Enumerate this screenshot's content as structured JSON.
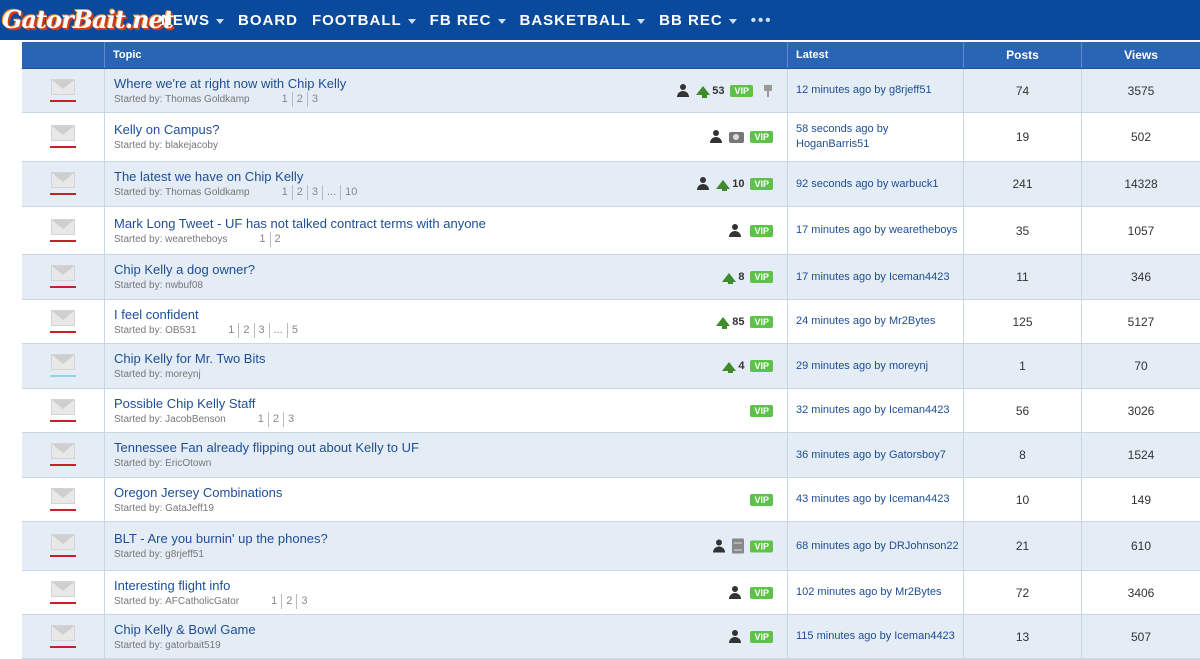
{
  "site": {
    "logo_text": "GatorBait.net"
  },
  "nav": {
    "items": [
      {
        "label": "NEWS",
        "dropdown": true
      },
      {
        "label": "BOARD",
        "dropdown": false
      },
      {
        "label": "FOOTBALL",
        "dropdown": true
      },
      {
        "label": "FB REC",
        "dropdown": true
      },
      {
        "label": "BASKETBALL",
        "dropdown": true
      },
      {
        "label": "BB REC",
        "dropdown": true
      }
    ],
    "more": "•••"
  },
  "table": {
    "headers": {
      "topic": "Topic",
      "latest": "Latest",
      "posts": "Posts",
      "views": "Views"
    },
    "started_prefix": "Started by:",
    "rows": [
      {
        "title": "Where we're at right now with Chip Kelly",
        "author": "Thomas Goldkamp",
        "pages": [
          "1",
          "2",
          "3"
        ],
        "person": true,
        "up": "53",
        "camera": false,
        "doc": false,
        "vip": true,
        "pin": true,
        "latest": "12 minutes ago by g8rjeff51",
        "posts": "74",
        "views": "3575",
        "bar": "red"
      },
      {
        "title": "Kelly on Campus?",
        "author": "blakejacoby",
        "pages": [],
        "person": true,
        "up": "",
        "camera": true,
        "doc": false,
        "vip": true,
        "pin": false,
        "latest": "58 seconds ago by HoganBarris51",
        "posts": "19",
        "views": "502",
        "bar": "red"
      },
      {
        "title": "The latest we have on Chip Kelly",
        "author": "Thomas Goldkamp",
        "pages": [
          "1",
          "2",
          "3",
          "...",
          "10"
        ],
        "person": true,
        "up": "10",
        "camera": false,
        "doc": false,
        "vip": true,
        "pin": false,
        "latest": "92 seconds ago by warbuck1",
        "posts": "241",
        "views": "14328",
        "bar": "red"
      },
      {
        "title": "Mark Long Tweet - UF has not talked contract terms with anyone",
        "author": "wearetheboys",
        "pages": [
          "1",
          "2"
        ],
        "person": true,
        "up": "",
        "camera": false,
        "doc": false,
        "vip": true,
        "pin": false,
        "latest": "17 minutes ago by wearetheboys",
        "posts": "35",
        "views": "1057",
        "bar": "red"
      },
      {
        "title": "Chip Kelly a dog owner?",
        "author": "nwbuf08",
        "pages": [],
        "person": false,
        "up": "8",
        "camera": false,
        "doc": false,
        "vip": true,
        "pin": false,
        "latest": "17 minutes ago by Iceman4423",
        "posts": "11",
        "views": "346",
        "bar": "red"
      },
      {
        "title": "I feel confident",
        "author": "OB531",
        "pages": [
          "1",
          "2",
          "3",
          "...",
          "5"
        ],
        "person": false,
        "up": "85",
        "camera": false,
        "doc": false,
        "vip": true,
        "pin": false,
        "latest": "24 minutes ago by Mr2Bytes",
        "posts": "125",
        "views": "5127",
        "bar": "red"
      },
      {
        "title": "Chip Kelly for Mr. Two Bits",
        "author": "moreynj",
        "pages": [],
        "person": false,
        "up": "4",
        "camera": false,
        "doc": false,
        "vip": true,
        "pin": false,
        "latest": "29 minutes ago by moreynj",
        "posts": "1",
        "views": "70",
        "bar": "light"
      },
      {
        "title": "Possible Chip Kelly Staff",
        "author": "JacobBenson",
        "pages": [
          "1",
          "2",
          "3"
        ],
        "person": false,
        "up": "",
        "camera": false,
        "doc": false,
        "vip": true,
        "pin": false,
        "latest": "32 minutes ago by Iceman4423",
        "posts": "56",
        "views": "3026",
        "bar": "red"
      },
      {
        "title": "Tennessee Fan already flipping out about Kelly to UF",
        "author": "EricOtown",
        "pages": [],
        "person": false,
        "up": "",
        "camera": false,
        "doc": false,
        "vip": false,
        "pin": false,
        "latest": "36 minutes ago by Gatorsboy7",
        "posts": "8",
        "views": "1524",
        "bar": "red"
      },
      {
        "title": "Oregon Jersey Combinations",
        "author": "GataJeff19",
        "pages": [],
        "person": false,
        "up": "",
        "camera": false,
        "doc": false,
        "vip": true,
        "pin": false,
        "latest": "43 minutes ago by Iceman4423",
        "posts": "10",
        "views": "149",
        "bar": "red"
      },
      {
        "title": "BLT - Are you burnin' up the phones?",
        "author": "g8rjeff51",
        "pages": [],
        "person": true,
        "up": "",
        "camera": false,
        "doc": true,
        "vip": true,
        "pin": false,
        "latest": "68 minutes ago by DRJohnson22",
        "posts": "21",
        "views": "610",
        "bar": "red"
      },
      {
        "title": "Interesting flight info",
        "author": "AFCatholicGator",
        "pages": [
          "1",
          "2",
          "3"
        ],
        "person": true,
        "up": "",
        "camera": false,
        "doc": false,
        "vip": true,
        "pin": false,
        "latest": "102 minutes ago by Mr2Bytes",
        "posts": "72",
        "views": "3406",
        "bar": "red"
      },
      {
        "title": "Chip Kelly & Bowl Game",
        "author": "gatorbait519",
        "pages": [],
        "person": true,
        "up": "",
        "camera": false,
        "doc": false,
        "vip": true,
        "pin": false,
        "latest": "115 minutes ago by Iceman4423",
        "posts": "13",
        "views": "507",
        "bar": "red"
      }
    ]
  },
  "badges": {
    "vip_label": "VIP"
  }
}
